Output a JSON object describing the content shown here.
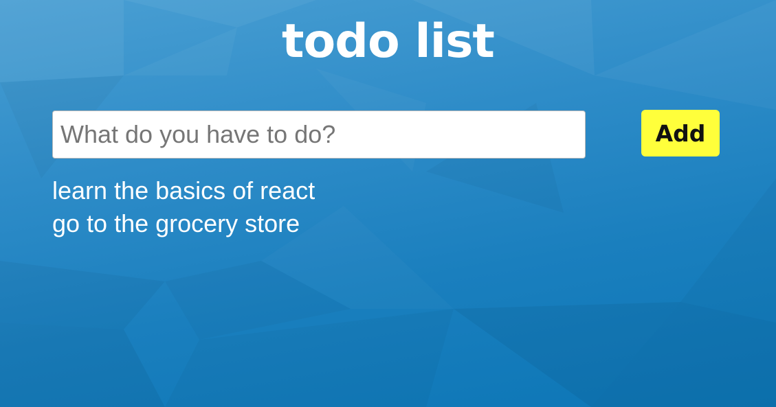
{
  "app": {
    "title": "todo list"
  },
  "form": {
    "input_value": "",
    "input_placeholder": "What do you have to do?",
    "add_label": "Add"
  },
  "todos": [
    {
      "text": "learn the basics of react"
    },
    {
      "text": "go to the grocery store"
    }
  ],
  "colors": {
    "background_top": "#4a9fd3",
    "background_bottom": "#0c76b6",
    "title_text": "#ffffff",
    "add_button": "#ffff3b",
    "add_button_text": "#111111",
    "todo_text": "#ffffff"
  }
}
